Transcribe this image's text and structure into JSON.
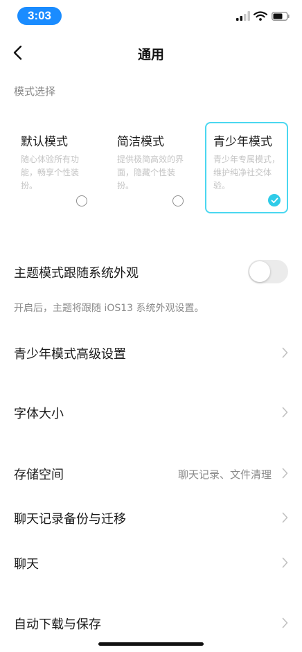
{
  "status_bar": {
    "time": "3:03"
  },
  "nav": {
    "title": "通用"
  },
  "mode_section": {
    "label": "模式选择",
    "modes": [
      {
        "name": "默认模式",
        "desc": "随心体验所有功能，畅享个性装扮。",
        "selected": false
      },
      {
        "name": "简洁模式",
        "desc": "提供极简高效的界面，隐藏个性装扮。",
        "selected": false
      },
      {
        "name": "青少年模式",
        "desc": "青少年专属模式，维护纯净社交体验。",
        "selected": true
      }
    ]
  },
  "theme_follow": {
    "label": "主题模式跟随系统外观",
    "enabled": false,
    "hint": "开启后，主题将跟随 iOS13 系统外观设置。"
  },
  "rows": [
    {
      "label": "青少年模式高级设置",
      "value": ""
    },
    {
      "label": "字体大小",
      "value": ""
    },
    {
      "label": "存储空间",
      "value": "聊天记录、文件清理"
    },
    {
      "label": "聊天记录备份与迁移",
      "value": ""
    },
    {
      "label": "聊天",
      "value": ""
    },
    {
      "label": "自动下载与保存",
      "value": ""
    }
  ],
  "colors": {
    "accent": "#2fcbe8",
    "selected_border": "#4ad7f0",
    "time_pill": "#1a8cff",
    "secondary_text": "#8a8a8a"
  },
  "icons": {
    "back": "chevron-left-icon",
    "row_arrow": "chevron-right-icon",
    "check": "checkmark-icon"
  }
}
